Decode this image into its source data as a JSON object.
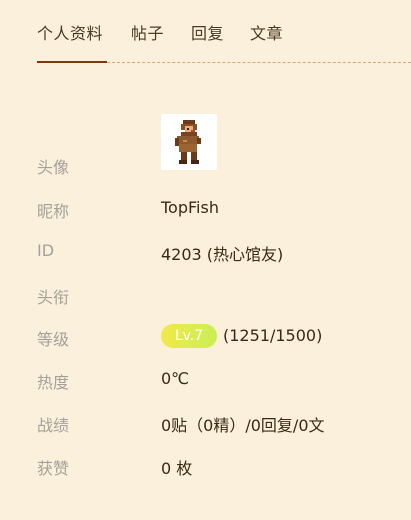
{
  "tabs": [
    {
      "label": "个人资料",
      "active": true
    },
    {
      "label": "帖子"
    },
    {
      "label": "回复"
    },
    {
      "label": "文章"
    }
  ],
  "profile": {
    "avatar_label": "头像",
    "nickname_label": "昵称",
    "nickname": "TopFish",
    "id_label": "ID",
    "id_value": "4203 (热心馆友)",
    "title_label": "头衔",
    "title_value": "",
    "level_label": "等级",
    "level_badge": "Lv.7",
    "level_progress": "(1251/1500)",
    "heat_label": "热度",
    "heat_value": "0℃",
    "record_label": "战绩",
    "record_value": "0贴（0精）/0回复/0文",
    "likes_label": "获赞",
    "likes_value": "0 枚"
  },
  "colors": {
    "background": "#faf0db",
    "accent": "#7a3a10",
    "badge_gradient_start": "#f2e948",
    "badge_gradient_end": "#c9ef54"
  }
}
